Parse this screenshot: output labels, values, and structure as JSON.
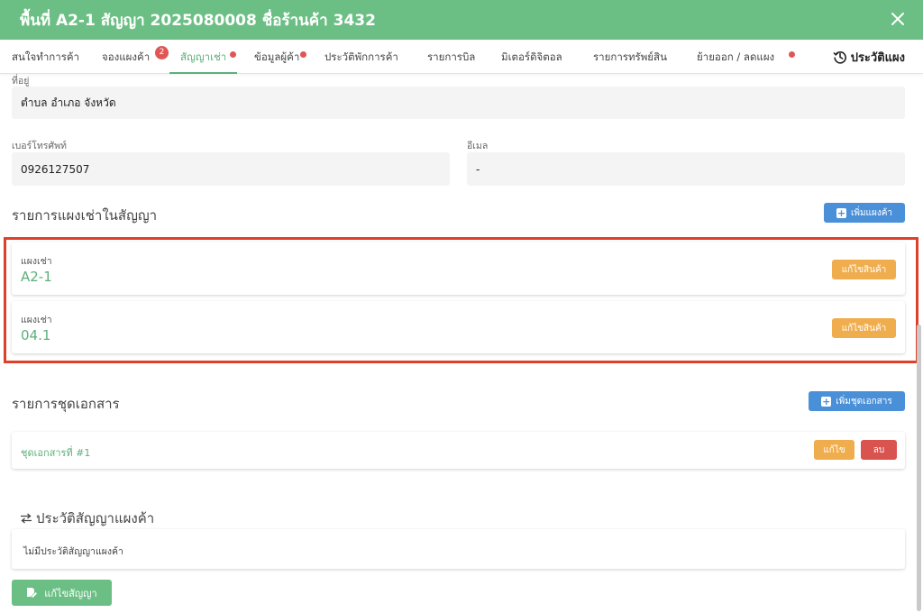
{
  "header": {
    "title": "พื้นที่ A2-1 สัญญา 2025080008 ชื่อร้านค้า 3432"
  },
  "tabs": [
    {
      "label": "สนใจทำการค้า"
    },
    {
      "label": "จองแผงค้า",
      "badge": "2"
    },
    {
      "label": "สัญญาเช่า"
    },
    {
      "label": "ข้อมูลผู้ค้า"
    },
    {
      "label": "ประวัติพักการค้า"
    },
    {
      "label": "รายการบิล"
    },
    {
      "label": "มิเตอร์ดิจิตอล"
    },
    {
      "label": "รายการทรัพย์สิน"
    },
    {
      "label": "ย้ายออก / ลดแผง"
    }
  ],
  "history_tab": {
    "label": "ประวัติแผง",
    "icon": "history-icon"
  },
  "address": {
    "label": "ที่อยู่",
    "value": "ตำบล อำเภอ จังหวัด"
  },
  "phone": {
    "label": "เบอร์โทรศัพท์",
    "value": "0926127507"
  },
  "email": {
    "label": "อีเมล",
    "value": "-"
  },
  "stalls_section": {
    "title": "รายการแผงเช่าในสัญญา",
    "add_button": "เพิ่มแผงค้า",
    "items": [
      {
        "label": "แผงเช่า",
        "value": "A2-1",
        "edit_button": "แก้ไขสินค้า"
      },
      {
        "label": "แผงเช่า",
        "value": "04.1",
        "edit_button": "แก้ไขสินค้า"
      }
    ]
  },
  "documents_section": {
    "title": "รายการชุดเอกสาร",
    "add_button": "เพิ่มชุดเอกสาร",
    "items": [
      {
        "label": "ชุดเอกสารที่ #1",
        "edit_button": "แก้ไข",
        "delete_button": "ลบ"
      }
    ]
  },
  "history_section": {
    "title": "ประวัติสัญญาแผงค้า",
    "icon": "swap-arrows-icon",
    "empty_text": "ไม่มีประวัติสัญญาแผงค้า"
  },
  "footer": {
    "edit_contract_button": "แก้ไขสัญญา",
    "icon": "edit-document-icon"
  },
  "colors": {
    "header_green": "#6cbf84",
    "accent_green": "#5cb07a",
    "blue": "#4a90d9",
    "orange": "#f0ad4e",
    "red": "#d9534f",
    "highlight_red": "#e0402a",
    "badge_red": "#e05656"
  }
}
